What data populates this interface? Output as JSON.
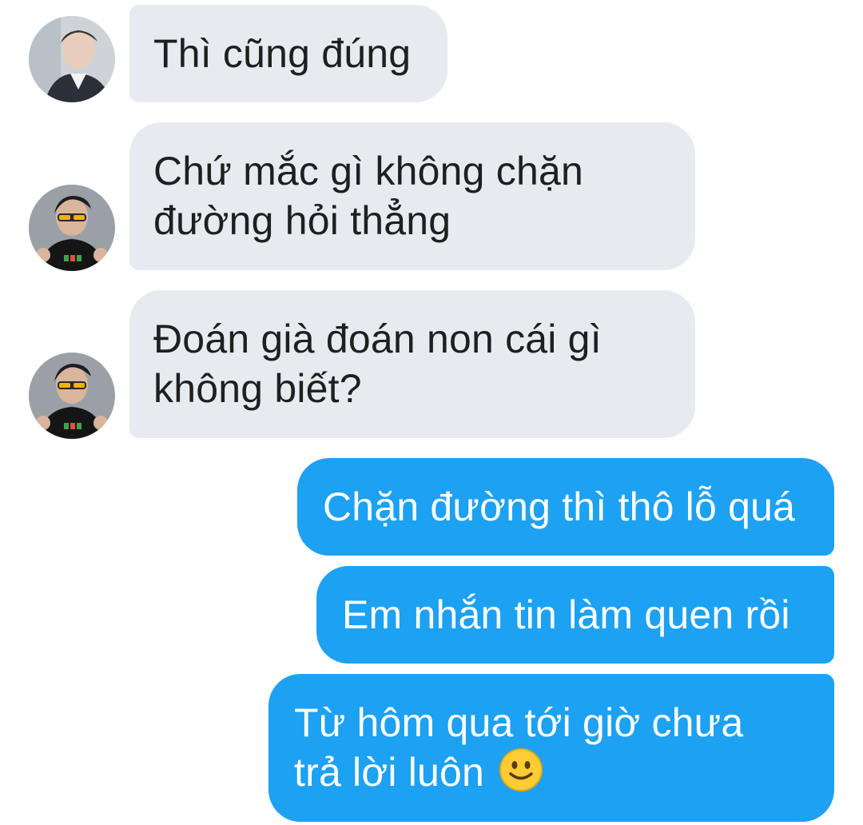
{
  "conversation": {
    "received": [
      {
        "text": "Thì cũng đúng",
        "avatar": "avatar-user-white-shirt"
      },
      {
        "lines": [
          "Chứ mắc gì không chặn",
          "đường hỏi thẳng"
        ],
        "avatar": "avatar-user-sunglasses"
      },
      {
        "lines": [
          "Đoán già đoán non cái gì",
          "không biết?"
        ],
        "avatar": "avatar-user-sunglasses"
      }
    ],
    "sent": [
      {
        "text": "Chặn đường thì thô lỗ quá"
      },
      {
        "text": "Em nhắn tin làm quen rồi"
      },
      {
        "lines": [
          "Từ hôm qua tới giờ chưa",
          "trả lời luôn"
        ],
        "emoji": "slightly-smiling-face-icon"
      }
    ]
  },
  "colors": {
    "received_bubble": "#e7ebef",
    "received_text": "#1f1f1f",
    "sent_bubble": "#1da1f2",
    "sent_text": "#ffffff",
    "background": "#ffffff"
  }
}
